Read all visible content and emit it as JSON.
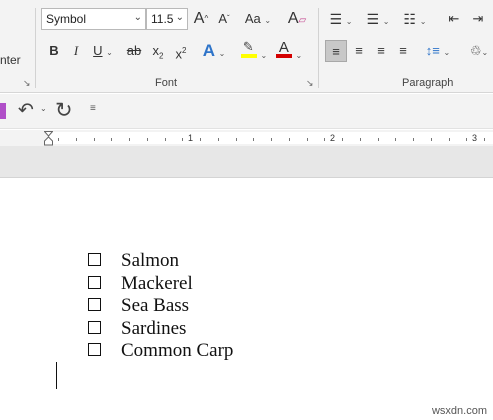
{
  "ribbon": {
    "left_label_partial": "nter",
    "font": {
      "font_name": "Symbol",
      "font_size": "11.5",
      "group_label": "Font",
      "grow_label": "A",
      "shrink_label": "A",
      "case_label": "Aa",
      "bold": "B",
      "italic": "I",
      "underline": "U",
      "strike": "ab",
      "subscript": "x",
      "superscript": "x",
      "effects": "A",
      "font_color": "A",
      "highlight_color": "#ffff00",
      "font_color_bar": "#d40000"
    },
    "paragraph": {
      "group_label": "Paragraph"
    }
  },
  "ruler": {
    "numbers": [
      "1",
      "2",
      "3"
    ]
  },
  "document": {
    "list_items": [
      "Salmon",
      "Mackerel",
      "Sea Bass",
      "Sardines",
      "Common Carp"
    ]
  },
  "watermark": "wsxdn.com"
}
